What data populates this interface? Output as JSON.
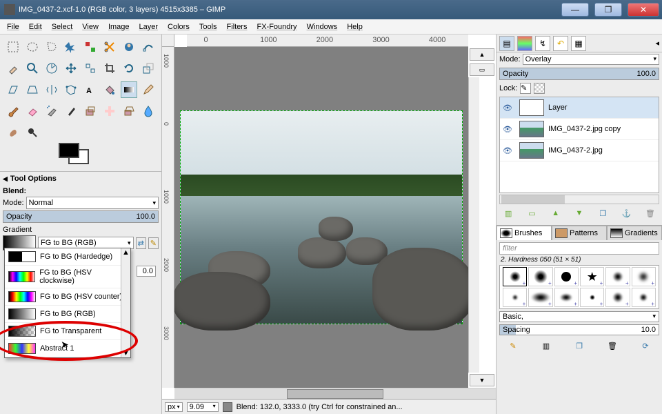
{
  "title": "IMG_0437-2.xcf-1.0 (RGB color, 3 layers) 4515x3385 – GIMP",
  "menu": [
    "File",
    "Edit",
    "Select",
    "View",
    "Image",
    "Layer",
    "Colors",
    "Tools",
    "Filters",
    "FX-Foundry",
    "Windows",
    "Help"
  ],
  "toolOptions": {
    "header": "Tool Options",
    "blendLabel": "Blend:",
    "modeLabel": "Mode:",
    "modeValue": "Normal",
    "opacityLabel": "Opacity",
    "opacityValue": "100.0",
    "gradientLabel": "Gradient",
    "gradientValue": "FG to BG (RGB)"
  },
  "gradientList": [
    {
      "name": "FG to BG (Hardedge)",
      "g": "linear-gradient(to right,#000 50%,#fff 50%)"
    },
    {
      "name": "FG to BG (HSV clockwise)",
      "g": "linear-gradient(to right,#000,#f0f,#00f,#0ff,#0f0,#ff0,#f00,#fff)"
    },
    {
      "name": "FG to BG (HSV counter)",
      "g": "linear-gradient(to right,#000,#f00,#ff0,#0f0,#0ff,#00f,#f0f,#fff)"
    },
    {
      "name": "FG to BG (RGB)",
      "g": "linear-gradient(to right,#000,#fff)"
    },
    {
      "name": "FG to Transparent",
      "g": "linear-gradient(to right,#000,transparent),repeating-conic-gradient(#ccc 0 25%,#fff 0 50%) 0/8px 8px"
    },
    {
      "name": "Abstract 1",
      "g": "linear-gradient(to right,#f33,#3f3,#33f,#ff3,#f3f)"
    }
  ],
  "gradientExtra": "0.0",
  "hruler": [
    "0",
    "1000",
    "2000",
    "3000",
    "4000"
  ],
  "vruler": [
    "1000",
    "0",
    "1000",
    "2000",
    "3000"
  ],
  "status": {
    "unit": "px",
    "zoom": "9.09",
    "msg": "Blend: 132.0, 3333.0 (try Ctrl for constrained an..."
  },
  "layersPanel": {
    "modeLabel": "Mode:",
    "modeValue": "Overlay",
    "opacityLabel": "Opacity",
    "opacityValue": "100.0",
    "lockLabel": "Lock:",
    "layers": [
      {
        "name": "Layer",
        "thumb": "blank",
        "sel": true
      },
      {
        "name": "IMG_0437-2.jpg copy",
        "thumb": "img"
      },
      {
        "name": "IMG_0437-2.jpg",
        "thumb": "img"
      }
    ]
  },
  "brushTabs": [
    "Brushes",
    "Patterns",
    "Gradients"
  ],
  "brushFilter": "filter",
  "brushInfo": "2. Hardness 050 (51 × 51)",
  "basicLabel": "Basic,",
  "spacingLabel": "Spacing",
  "spacingValue": "10.0"
}
